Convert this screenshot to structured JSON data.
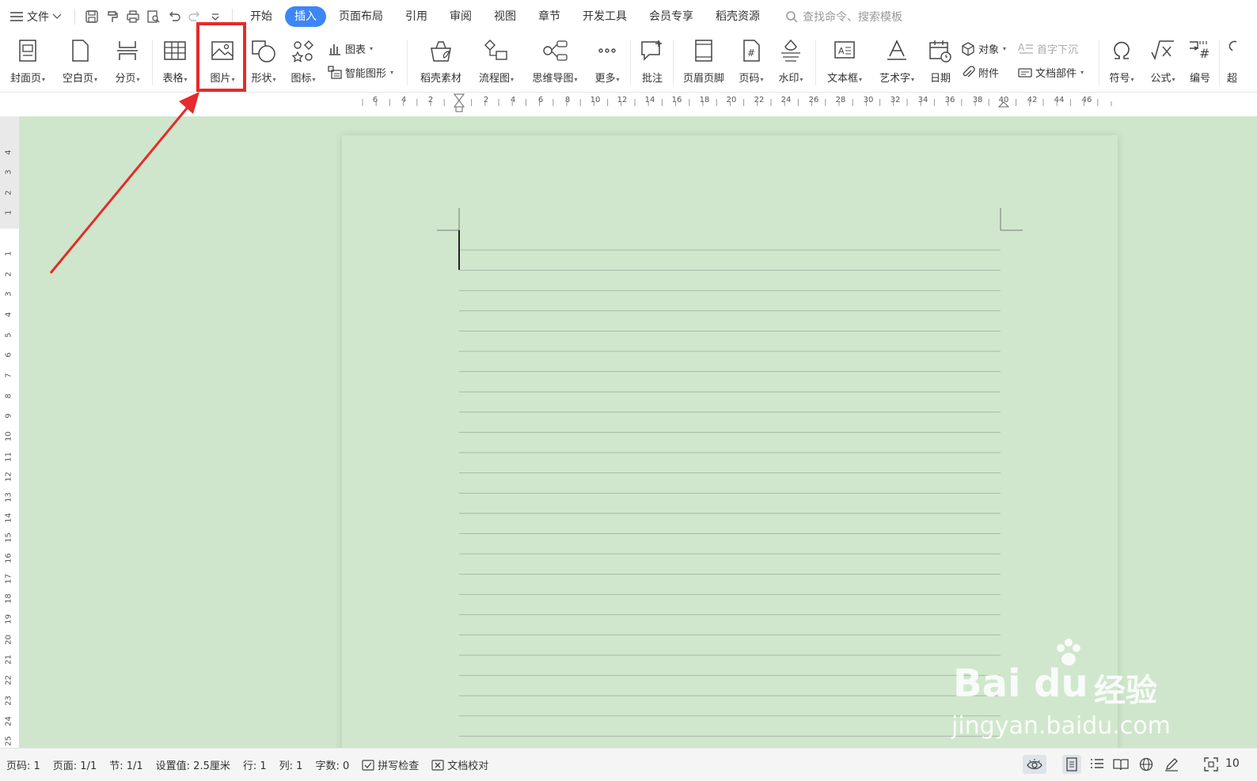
{
  "menubar": {
    "file_label": "文件",
    "tabs": [
      {
        "label": "开始",
        "active": false
      },
      {
        "label": "插入",
        "active": true
      },
      {
        "label": "页面布局",
        "active": false
      },
      {
        "label": "引用",
        "active": false
      },
      {
        "label": "审阅",
        "active": false
      },
      {
        "label": "视图",
        "active": false
      },
      {
        "label": "章节",
        "active": false
      },
      {
        "label": "开发工具",
        "active": false
      },
      {
        "label": "会员专享",
        "active": false
      },
      {
        "label": "稻壳资源",
        "active": false
      }
    ],
    "search_placeholder": "查找命令、搜索模板"
  },
  "ribbon": {
    "cover_page": "封面页",
    "blank_page": "空白页",
    "page_break": "分页",
    "table": "表格",
    "picture": "图片",
    "shape": "形状",
    "icon": "图标",
    "chart": "图表",
    "smart_graphic": "智能图形",
    "docer_material": "稻壳素材",
    "flowchart": "流程图",
    "mindmap": "思维导图",
    "more": "更多",
    "comment": "批注",
    "header_footer": "页眉页脚",
    "page_number": "页码",
    "watermark": "水印",
    "textbox": "文本框",
    "wordart": "艺术字",
    "date": "日期",
    "object": "对象",
    "dropcap": "首字下沉",
    "attachment": "附件",
    "doc_parts": "文档部件",
    "symbol": "符号",
    "formula": "公式",
    "numbering": "编号",
    "hyperlink_partial": "超"
  },
  "ruler": {
    "h_ticks": [
      "6",
      "4",
      "2",
      "2",
      "4",
      "6",
      "8",
      "10",
      "12",
      "14",
      "16",
      "18",
      "20",
      "22",
      "24",
      "26",
      "28",
      "30",
      "32",
      "34",
      "36",
      "38",
      "40",
      "42",
      "44",
      "46"
    ],
    "v_ticks": [
      "4",
      "3",
      "2",
      "1",
      "1",
      "2",
      "3",
      "4",
      "5",
      "6",
      "7",
      "8",
      "9",
      "10",
      "11",
      "12",
      "13",
      "14",
      "15",
      "16",
      "17",
      "18",
      "19",
      "20",
      "21",
      "22",
      "23",
      "24",
      "25"
    ]
  },
  "statusbar": {
    "page_no": "页码: 1",
    "pages": "页面: 1/1",
    "section": "节: 1/1",
    "setting": "设置值: 2.5厘米",
    "row": "行: 1",
    "col": "列: 1",
    "word_count": "字数: 0",
    "spell_check": "拼写检查",
    "doc_proof": "文档校对",
    "zoom_partial": "10"
  },
  "watermark": {
    "brand": "Bai  du",
    "brand_cn": "经验",
    "url": "jingyan.baidu.com"
  },
  "colors": {
    "accent": "#3d86f5",
    "highlight": "#e52b2b",
    "canvas": "#cfe6cc",
    "page": "#d0e7cd"
  }
}
